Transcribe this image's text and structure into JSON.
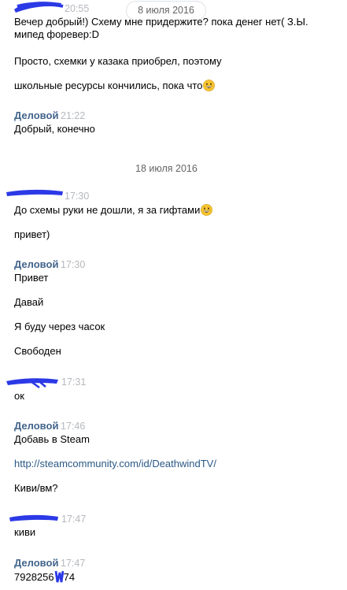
{
  "colors": {
    "sender": "#42648b",
    "time": "#b5b8bd",
    "text": "#000000",
    "link": "#2a5885",
    "redaction": "#2b39e6",
    "divider_text": "#656565"
  },
  "header_date_pill": "8 июля 2016",
  "date_divider_2": "18 июля 2016",
  "messages": [
    {
      "sender": "",
      "time": "20:55",
      "lines": [
        "Вечер добрый!) Схему мне придержите? пока денег нет( З.Ы.",
        "мипед форевер:D",
        "Просто, схемки у казака приобрел, поэтому",
        "школьные ресурсы кончились, пока что"
      ]
    },
    {
      "sender": "Деловой",
      "time": "21:22",
      "lines": [
        "Добрый, конечно"
      ]
    },
    {
      "sender": "",
      "time": "17:30",
      "lines": [
        "До схемы руки не дошли, я за гифтами",
        "привет)"
      ]
    },
    {
      "sender": "Деловой",
      "time": "17:30",
      "lines": [
        "Привет",
        "Давай",
        "Я буду через часок",
        "Свободен"
      ]
    },
    {
      "sender": "",
      "time": "17:31",
      "lines": [
        "ок"
      ]
    },
    {
      "sender": "Деловой",
      "time": "17:46",
      "lines": [
        "Добавь в Steam",
        "http://steamcommunity.com/id/DeathwindTV/",
        "Киви/вм?"
      ]
    },
    {
      "sender": "",
      "time": "17:47",
      "lines": [
        "киви"
      ]
    },
    {
      "sender": "Деловой",
      "time": "17:47",
      "phone_start": "7928256",
      "phone_end": "74"
    }
  ],
  "icons": {
    "emoji": "grinning-face-icon",
    "redaction": "scribble-redaction"
  }
}
